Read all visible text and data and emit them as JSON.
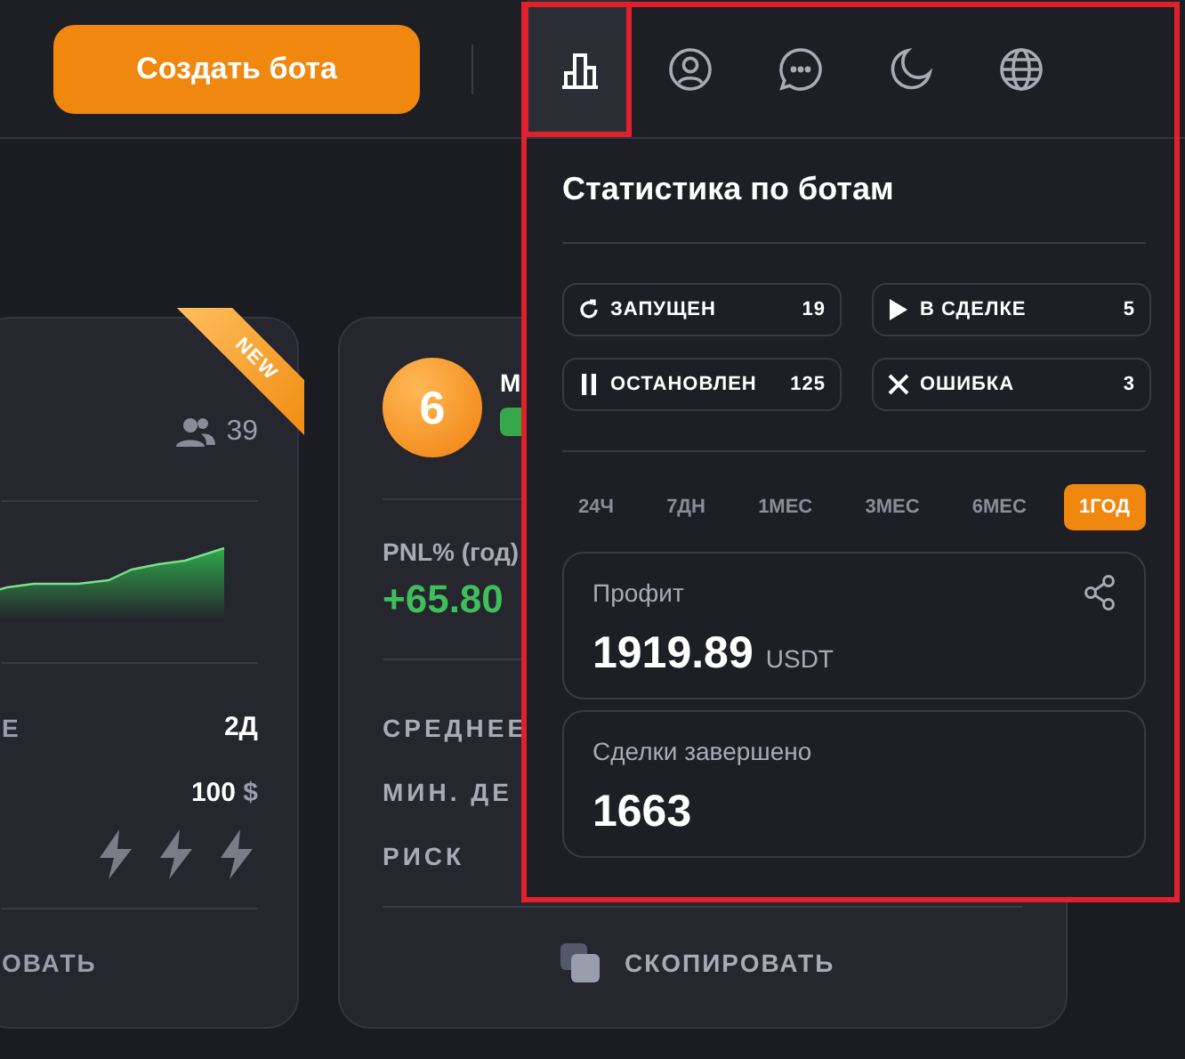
{
  "header": {
    "create_button": "Создать бота",
    "nav_icons": [
      {
        "kind": "stats",
        "selected": true
      },
      {
        "kind": "profile",
        "selected": false
      },
      {
        "kind": "chat",
        "selected": false
      },
      {
        "kind": "theme",
        "selected": false
      },
      {
        "kind": "language",
        "selected": false
      }
    ]
  },
  "left_card": {
    "ribbon": "NEW",
    "subscribers": "39",
    "duration_label": "Е",
    "duration": "2Д",
    "deposit": "100",
    "deposit_unit": "$",
    "copy_button": "ОВАТЬ"
  },
  "bot_card": {
    "rank": "6",
    "name": "М",
    "pnl_label": "PNL% (год)",
    "pnl": "+65.80",
    "labels": [
      "СРЕДНЕЕ",
      "МИН. ДЕ",
      "РИСК"
    ],
    "copy_button": "СКОПИРОВАТЬ"
  },
  "panel": {
    "title": "Статистика по ботам",
    "statuses": [
      {
        "kind": "running",
        "label": "ЗАПУЩЕН",
        "count": "19"
      },
      {
        "kind": "in_trade",
        "label": "В СДЕЛКЕ",
        "count": "5"
      },
      {
        "kind": "stopped",
        "label": "ОСТАНОВЛЕН",
        "count": "125"
      },
      {
        "kind": "error",
        "label": "ОШИБКА",
        "count": "3"
      }
    ],
    "periods": [
      {
        "label": "24Ч",
        "selected": false
      },
      {
        "label": "7ДН",
        "selected": false
      },
      {
        "label": "1МЕС",
        "selected": false
      },
      {
        "label": "3МЕС",
        "selected": false
      },
      {
        "label": "6МЕС",
        "selected": false
      },
      {
        "label": "1ГОД",
        "selected": true
      }
    ],
    "profit": {
      "label": "Профит",
      "value": "1919.89",
      "unit": "USDT"
    },
    "deals": {
      "label": "Сделки завершено",
      "value": "1663"
    }
  }
}
